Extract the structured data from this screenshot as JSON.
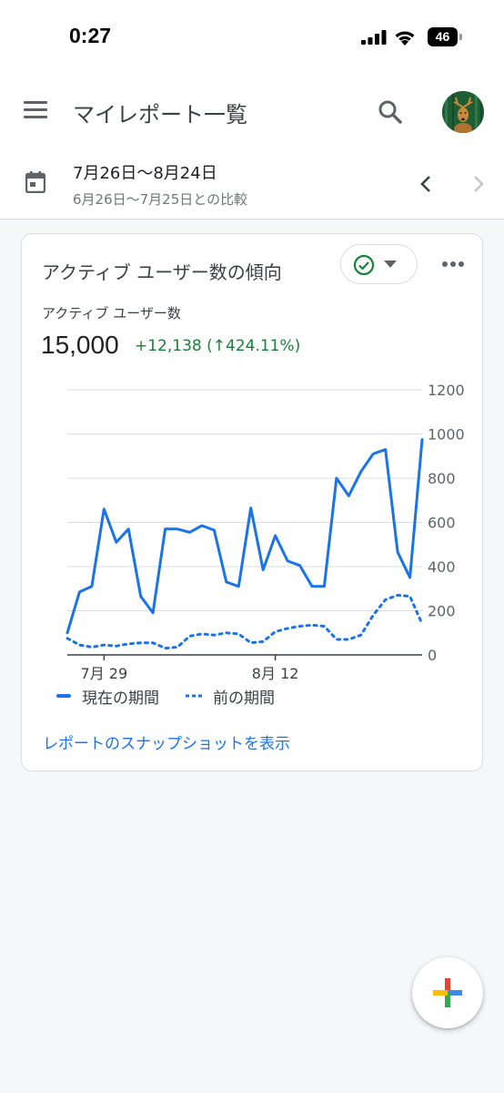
{
  "status_bar": {
    "time": "0:27",
    "battery": "46"
  },
  "app_bar": {
    "title": "マイレポート一覧"
  },
  "date_bar": {
    "range": "7月26日〜8月24日",
    "comparison": "6月26日〜7月25日との比較"
  },
  "card": {
    "title": "アクティブ ユーザー数の傾向",
    "metric_label": "アクティブ ユーザー数",
    "metric_value": "15,000",
    "metric_change": "+12,138 (↑424.11%)",
    "snapshot_link": "レポートのスナップショットを表示"
  },
  "colors": {
    "accent": "#1a73e8",
    "positive": "#188038"
  },
  "chart_data": {
    "type": "line",
    "x_ticks": [
      "7月 29",
      "8月 12"
    ],
    "y_ticks": [
      "0",
      "200",
      "400",
      "600",
      "800",
      "1000",
      "1200"
    ],
    "ylim": [
      0,
      1200
    ],
    "grid": true,
    "legend_position": "bottom",
    "series": [
      {
        "name": "現在の期間",
        "style": "solid",
        "color": "#1a73e8",
        "values": [
          100,
          285,
          310,
          660,
          510,
          570,
          265,
          190,
          570,
          570,
          555,
          585,
          565,
          330,
          310,
          665,
          385,
          540,
          425,
          405,
          310,
          310,
          800,
          720,
          830,
          910,
          930,
          465,
          350,
          975
        ]
      },
      {
        "name": "前の期間",
        "style": "dotted",
        "color": "#1a73e8",
        "values": [
          75,
          45,
          35,
          45,
          40,
          50,
          55,
          55,
          30,
          35,
          85,
          95,
          90,
          100,
          95,
          55,
          60,
          105,
          120,
          130,
          135,
          130,
          70,
          70,
          90,
          180,
          250,
          270,
          265,
          140
        ]
      }
    ]
  },
  "icons": {
    "menu": "hamburger-menu-icon",
    "search": "search-icon",
    "calendar": "calendar-icon",
    "check": "check-circle-icon",
    "more": "more-horizontal-icon",
    "add": "add-plus-icon"
  }
}
